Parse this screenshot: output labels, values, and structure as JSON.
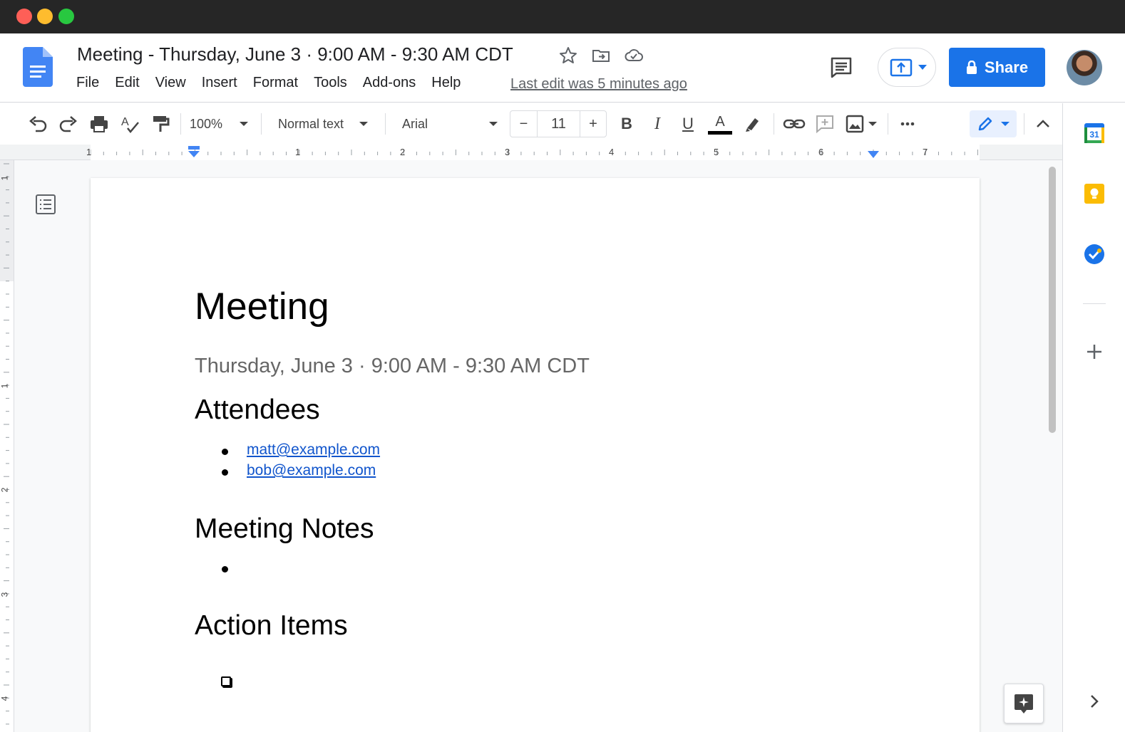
{
  "doc": {
    "title": "Meeting - Thursday, June 3 · 9:00 AM - 9:30 AM CDT",
    "last_edit": "Last edit was 5 minutes ago"
  },
  "menu": [
    "File",
    "Edit",
    "View",
    "Insert",
    "Format",
    "Tools",
    "Add-ons",
    "Help"
  ],
  "share": {
    "label": "Share"
  },
  "toolbar": {
    "zoom": "100%",
    "style": "Normal text",
    "font": "Arial",
    "font_size": "11",
    "bold": "B",
    "italic": "I",
    "underline": "U",
    "text_color": "A",
    "text_color_value": "#000000"
  },
  "ruler": {
    "numbers": [
      "1",
      "1",
      "2",
      "3",
      "4",
      "5",
      "6",
      "7"
    ],
    "vertical_numbers": [
      "1",
      "1",
      "2",
      "3",
      "4"
    ]
  },
  "document": {
    "heading": "Meeting",
    "subtitle": "Thursday, June 3 · 9:00 AM - 9:30 AM CDT",
    "sections": {
      "attendees": "Attendees",
      "notes": "Meeting Notes",
      "actions": "Action Items"
    },
    "attendees": [
      "matt@example.com",
      "bob@example.com"
    ]
  },
  "colors": {
    "accent": "#1a73e8",
    "link": "#1155cc",
    "titlebar": "#262626"
  },
  "side_panel": {
    "calendar_label": "31",
    "icons": [
      "calendar-icon",
      "keep-icon",
      "tasks-icon",
      "add-icon",
      "expand-icon"
    ]
  }
}
